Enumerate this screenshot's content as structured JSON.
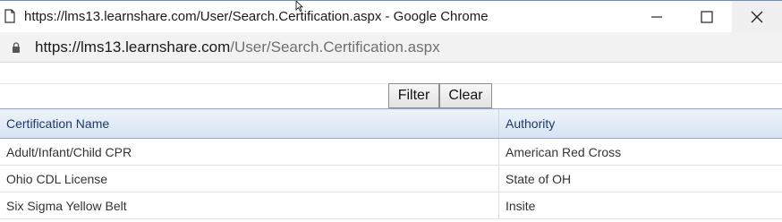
{
  "window": {
    "title": "https://lms13.learnshare.com/User/Search.Certification.aspx - Google Chrome"
  },
  "address": {
    "host": "https://lms13.learnshare.com",
    "path": "/User/Search.Certification.aspx"
  },
  "toolbar": {
    "filter_label": "Filter",
    "clear_label": "Clear"
  },
  "table": {
    "headers": [
      "Certification Name",
      "Authority"
    ],
    "rows": [
      [
        "Adult/Infant/Child CPR",
        "American Red Cross"
      ],
      [
        "Ohio CDL License",
        "State of OH"
      ],
      [
        "Six Sigma Yellow Belt",
        "Insite"
      ]
    ]
  },
  "colors": {
    "header_text": "#1f3a66",
    "header_bg": "#d6e3f3",
    "url_path": "#707070"
  }
}
